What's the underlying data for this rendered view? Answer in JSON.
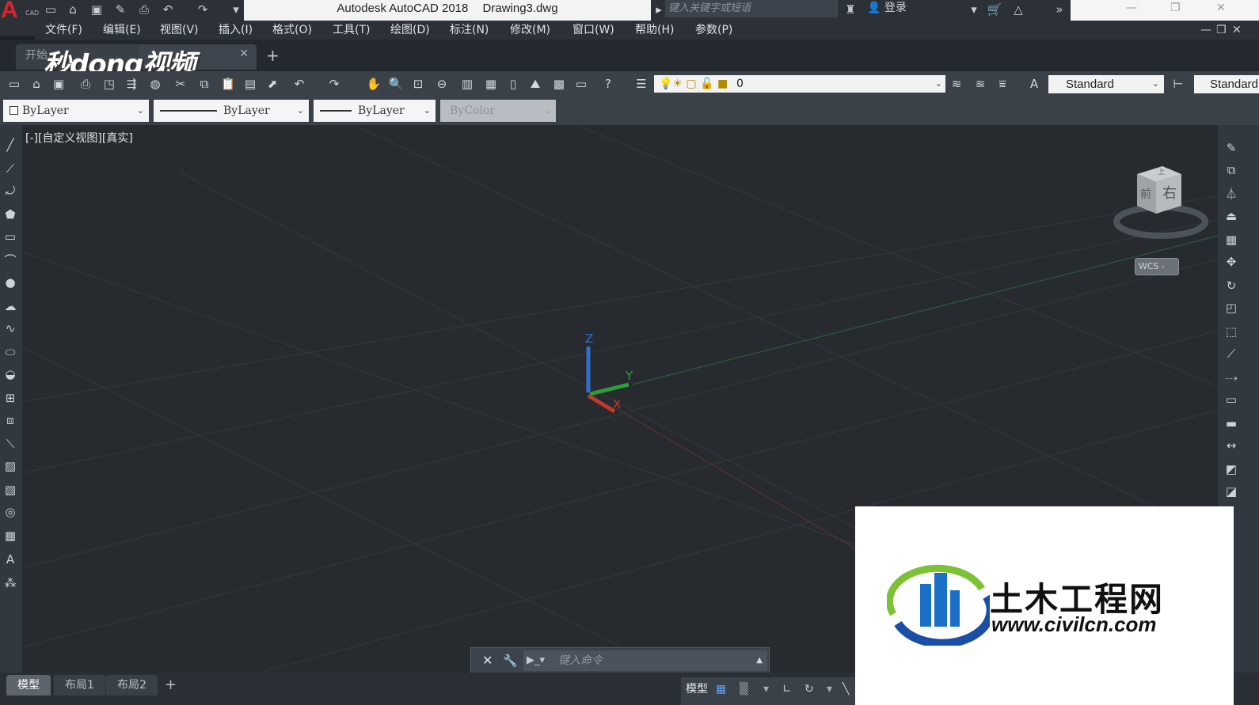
{
  "app": {
    "logo_letter": "A",
    "logo_sub": "CAD",
    "title": "Autodesk AutoCAD 2018",
    "document": "Drawing3.dwg",
    "search_placeholder": "键入关键字或短语",
    "signin": "登录"
  },
  "menu": [
    "文件(F)",
    "编辑(E)",
    "视图(V)",
    "插入(I)",
    "格式(O)",
    "工具(T)",
    "绘图(D)",
    "标注(N)",
    "修改(M)",
    "窗口(W)",
    "帮助(H)",
    "参数(P)"
  ],
  "tabs": {
    "start": "开始",
    "add": "+"
  },
  "watermark_top": "秒dong视频",
  "layer": {
    "value": "0"
  },
  "text_style": {
    "value": "Standard"
  },
  "dim_style": {
    "value": "Standard"
  },
  "properties": {
    "color": "ByLayer",
    "linetype": "ByLayer",
    "lineweight": "ByLayer",
    "plotstyle": "ByColor"
  },
  "viewport": {
    "label": "[-][自定义视图][真实]",
    "ucs": {
      "x": "X",
      "y": "Y",
      "z": "Z"
    },
    "viewcube": {
      "front": "前",
      "right": "右",
      "top": "上",
      "wcs": "WCS"
    },
    "colors": {
      "x_axis": "#c0392b",
      "y_axis": "#2e9d3a",
      "z_axis": "#2f6fd1"
    }
  },
  "layouts": [
    "模型",
    "布局1",
    "布局2"
  ],
  "layout_add": "+",
  "status": {
    "model": "模型"
  },
  "command": {
    "placeholder": "键入命令"
  },
  "watermark_box": {
    "name": "土木工程网",
    "url": "www.civilcn.com"
  }
}
